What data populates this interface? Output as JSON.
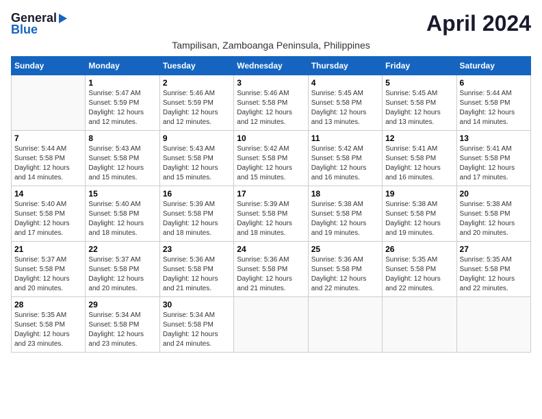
{
  "logo": {
    "line1": "General",
    "line2": "Blue"
  },
  "month_title": "April 2024",
  "subtitle": "Tampilisan, Zamboanga Peninsula, Philippines",
  "headers": [
    "Sunday",
    "Monday",
    "Tuesday",
    "Wednesday",
    "Thursday",
    "Friday",
    "Saturday"
  ],
  "weeks": [
    [
      {
        "day": "",
        "info": ""
      },
      {
        "day": "1",
        "info": "Sunrise: 5:47 AM\nSunset: 5:59 PM\nDaylight: 12 hours\nand 12 minutes."
      },
      {
        "day": "2",
        "info": "Sunrise: 5:46 AM\nSunset: 5:59 PM\nDaylight: 12 hours\nand 12 minutes."
      },
      {
        "day": "3",
        "info": "Sunrise: 5:46 AM\nSunset: 5:58 PM\nDaylight: 12 hours\nand 12 minutes."
      },
      {
        "day": "4",
        "info": "Sunrise: 5:45 AM\nSunset: 5:58 PM\nDaylight: 12 hours\nand 13 minutes."
      },
      {
        "day": "5",
        "info": "Sunrise: 5:45 AM\nSunset: 5:58 PM\nDaylight: 12 hours\nand 13 minutes."
      },
      {
        "day": "6",
        "info": "Sunrise: 5:44 AM\nSunset: 5:58 PM\nDaylight: 12 hours\nand 14 minutes."
      }
    ],
    [
      {
        "day": "7",
        "info": "Sunrise: 5:44 AM\nSunset: 5:58 PM\nDaylight: 12 hours\nand 14 minutes."
      },
      {
        "day": "8",
        "info": "Sunrise: 5:43 AM\nSunset: 5:58 PM\nDaylight: 12 hours\nand 15 minutes."
      },
      {
        "day": "9",
        "info": "Sunrise: 5:43 AM\nSunset: 5:58 PM\nDaylight: 12 hours\nand 15 minutes."
      },
      {
        "day": "10",
        "info": "Sunrise: 5:42 AM\nSunset: 5:58 PM\nDaylight: 12 hours\nand 15 minutes."
      },
      {
        "day": "11",
        "info": "Sunrise: 5:42 AM\nSunset: 5:58 PM\nDaylight: 12 hours\nand 16 minutes."
      },
      {
        "day": "12",
        "info": "Sunrise: 5:41 AM\nSunset: 5:58 PM\nDaylight: 12 hours\nand 16 minutes."
      },
      {
        "day": "13",
        "info": "Sunrise: 5:41 AM\nSunset: 5:58 PM\nDaylight: 12 hours\nand 17 minutes."
      }
    ],
    [
      {
        "day": "14",
        "info": "Sunrise: 5:40 AM\nSunset: 5:58 PM\nDaylight: 12 hours\nand 17 minutes."
      },
      {
        "day": "15",
        "info": "Sunrise: 5:40 AM\nSunset: 5:58 PM\nDaylight: 12 hours\nand 18 minutes."
      },
      {
        "day": "16",
        "info": "Sunrise: 5:39 AM\nSunset: 5:58 PM\nDaylight: 12 hours\nand 18 minutes."
      },
      {
        "day": "17",
        "info": "Sunrise: 5:39 AM\nSunset: 5:58 PM\nDaylight: 12 hours\nand 18 minutes."
      },
      {
        "day": "18",
        "info": "Sunrise: 5:38 AM\nSunset: 5:58 PM\nDaylight: 12 hours\nand 19 minutes."
      },
      {
        "day": "19",
        "info": "Sunrise: 5:38 AM\nSunset: 5:58 PM\nDaylight: 12 hours\nand 19 minutes."
      },
      {
        "day": "20",
        "info": "Sunrise: 5:38 AM\nSunset: 5:58 PM\nDaylight: 12 hours\nand 20 minutes."
      }
    ],
    [
      {
        "day": "21",
        "info": "Sunrise: 5:37 AM\nSunset: 5:58 PM\nDaylight: 12 hours\nand 20 minutes."
      },
      {
        "day": "22",
        "info": "Sunrise: 5:37 AM\nSunset: 5:58 PM\nDaylight: 12 hours\nand 20 minutes."
      },
      {
        "day": "23",
        "info": "Sunrise: 5:36 AM\nSunset: 5:58 PM\nDaylight: 12 hours\nand 21 minutes."
      },
      {
        "day": "24",
        "info": "Sunrise: 5:36 AM\nSunset: 5:58 PM\nDaylight: 12 hours\nand 21 minutes."
      },
      {
        "day": "25",
        "info": "Sunrise: 5:36 AM\nSunset: 5:58 PM\nDaylight: 12 hours\nand 22 minutes."
      },
      {
        "day": "26",
        "info": "Sunrise: 5:35 AM\nSunset: 5:58 PM\nDaylight: 12 hours\nand 22 minutes."
      },
      {
        "day": "27",
        "info": "Sunrise: 5:35 AM\nSunset: 5:58 PM\nDaylight: 12 hours\nand 22 minutes."
      }
    ],
    [
      {
        "day": "28",
        "info": "Sunrise: 5:35 AM\nSunset: 5:58 PM\nDaylight: 12 hours\nand 23 minutes."
      },
      {
        "day": "29",
        "info": "Sunrise: 5:34 AM\nSunset: 5:58 PM\nDaylight: 12 hours\nand 23 minutes."
      },
      {
        "day": "30",
        "info": "Sunrise: 5:34 AM\nSunset: 5:58 PM\nDaylight: 12 hours\nand 24 minutes."
      },
      {
        "day": "",
        "info": ""
      },
      {
        "day": "",
        "info": ""
      },
      {
        "day": "",
        "info": ""
      },
      {
        "day": "",
        "info": ""
      }
    ]
  ]
}
